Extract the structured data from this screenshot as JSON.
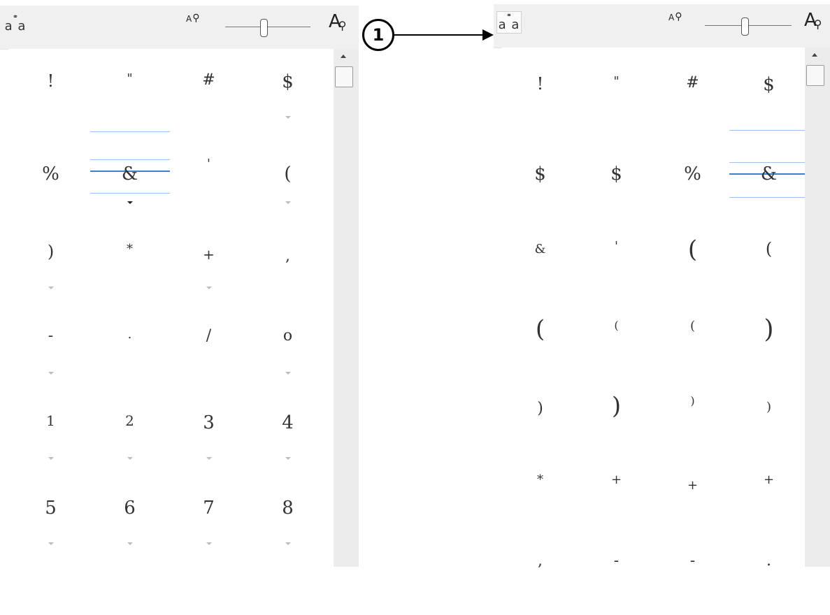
{
  "toolbar": {
    "alt_glyph_icon_top": "⚭",
    "alt_glyph_icon_main": "a a",
    "zoom_small_letter": "A",
    "zoom_small_mag": "⚲",
    "zoom_large_letter": "A",
    "zoom_large_mag": "⚲"
  },
  "slider": {
    "zoom_level": 0.45
  },
  "callout": {
    "label": "1"
  },
  "left_panel": {
    "rows": [
      [
        "!",
        "\"",
        "#",
        "$"
      ],
      [
        "%",
        "&",
        "'",
        "("
      ],
      [
        ")",
        "*",
        "+",
        ","
      ],
      [
        "-",
        ".",
        "/",
        "o"
      ],
      [
        "1",
        "2",
        "3",
        "4"
      ],
      [
        "5",
        "6",
        "7",
        "8"
      ]
    ]
  },
  "right_panel": {
    "rows": [
      [
        "!",
        "\"",
        "#",
        "$"
      ],
      [
        "$",
        "$",
        "%",
        "&"
      ],
      [
        "&",
        "'",
        "(",
        "("
      ],
      [
        "(",
        "(",
        "(",
        ")"
      ],
      [
        ")",
        ")",
        ")",
        ")"
      ],
      [
        "*",
        "+",
        "+",
        "+"
      ],
      [
        ",",
        "-",
        "-",
        "."
      ]
    ]
  },
  "colors": {
    "toolbar_bg": "#f0f0f0",
    "highlight_blue": "#3a7fd4",
    "guide_blue": "#9cc3ef"
  }
}
